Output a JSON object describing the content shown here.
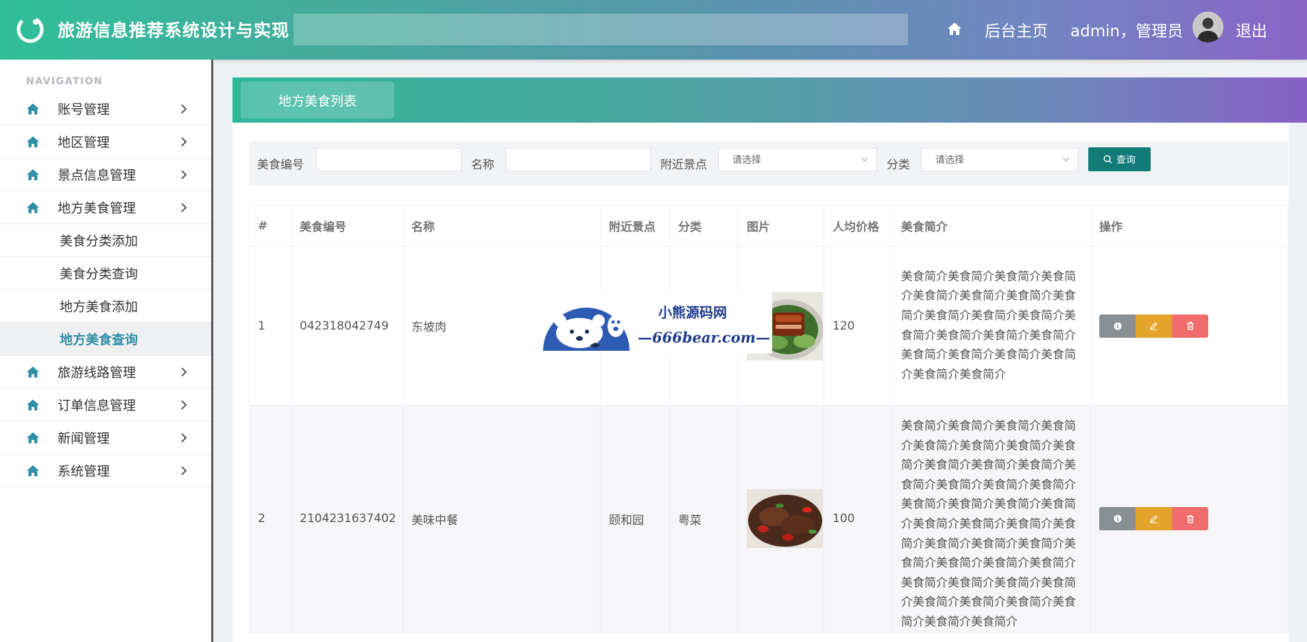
{
  "header": {
    "app_title": "旅游信息推荐系统设计与实现",
    "home_label": "后台主页",
    "user_label": "admin，管理员",
    "logout_label": "退出"
  },
  "sidebar": {
    "heading": "NAVIGATION",
    "items": [
      {
        "label": "账号管理"
      },
      {
        "label": "地区管理"
      },
      {
        "label": "景点信息管理"
      },
      {
        "label": "地方美食管理"
      }
    ],
    "sub_items": [
      {
        "label": "美食分类添加"
      },
      {
        "label": "美食分类查询"
      },
      {
        "label": "地方美食添加"
      },
      {
        "label": "地方美食查询"
      }
    ],
    "items_after": [
      {
        "label": "旅游线路管理"
      },
      {
        "label": "订单信息管理"
      },
      {
        "label": "新闻管理"
      },
      {
        "label": "系统管理"
      }
    ]
  },
  "panel": {
    "title": "地方美食列表"
  },
  "search": {
    "code_label": "美食编号",
    "code_value": "",
    "name_label": "名称",
    "name_value": "",
    "spot_label": "附近景点",
    "spot_selected": "请选择",
    "category_label": "分类",
    "category_selected": "请选择",
    "button_label": "查询"
  },
  "table": {
    "headers": [
      "#",
      "美食编号",
      "名称",
      "附近景点",
      "分类",
      "图片",
      "人均价格",
      "美食简介",
      "操作"
    ],
    "rows": [
      {
        "index": "1",
        "code": "042318042749",
        "name": "东坡肉",
        "spot": "",
        "category": "",
        "price": "120",
        "desc": "美食简介美食简介美食简介美食简介美食简介美食简介美食简介美食简介美食简介美食简介美食简介美食简介美食简介美食简介美食简介美食简介美食简介美食简介美食简介美食简介美食简介"
      },
      {
        "index": "2",
        "code": "2104231637402",
        "name": "美味中餐",
        "spot": "颐和园",
        "category": "粤菜",
        "price": "100",
        "desc": "美食简介美食简介美食简介美食简介美食简介美食简介美食简介美食简介美食简介美食简介美食简介美食简介美食简介美食简介美食简介美食简介美食简介美食简介美食简介美食简介美食简介美食简介美食简介美食简介美食简介美食简介美食简介美食简介美食简介美食简介美食简介美食简介美食简介美食简介美食简介美食简介美食简介美食简介美食简介美食简介"
      }
    ]
  },
  "watermark": {
    "title": "小熊源码网",
    "url": "—666bear.com—"
  },
  "colors": {
    "header_gradient_start": "#2fbf9a",
    "header_gradient_end": "#8a63c8",
    "accent": "#127b78",
    "active_nav_text": "#2f8fa6",
    "btn_info": "#8a8f94",
    "btn_edit": "#e4a32a",
    "btn_delete": "#f16d6d"
  },
  "icons": {
    "logo": "refresh-ring-icon",
    "home": "home-icon",
    "chevron": "chevron-right-icon",
    "search": "search-icon",
    "info": "info-icon",
    "edit": "pencil-icon",
    "delete": "trash-icon"
  }
}
